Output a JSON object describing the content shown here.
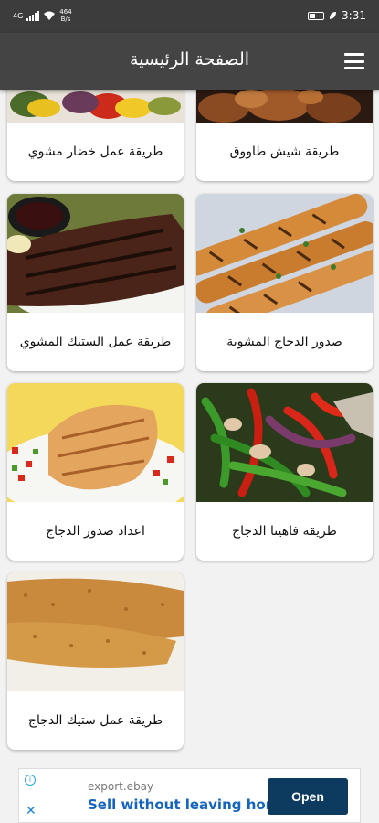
{
  "status_bar": {
    "network": "4G",
    "speed_value": "464",
    "speed_unit": "B/s",
    "time": "3:31"
  },
  "app_bar": {
    "title": "الصفحة الرئيسية",
    "menu_icon": "hamburger-menu-icon"
  },
  "recipes": [
    {
      "title": "طريقة شيش طاووق",
      "image": "grilled-chicken-pieces"
    },
    {
      "title": "طريقة عمل خضار مشوي",
      "image": "grilled-vegetables"
    },
    {
      "title": "صدور الدجاج المشوية",
      "image": "grilled-chicken-skewers"
    },
    {
      "title": "طريقة عمل الستيك المشوي",
      "image": "grilled-steak"
    },
    {
      "title": "طريقة فاهيتا الدجاج",
      "image": "chicken-fajita"
    },
    {
      "title": "اعداد صدور الدجاج",
      "image": "chicken-breast-plate"
    },
    {
      "title": "طريقة عمل ستيك الدجاج",
      "image": "breaded-chicken-steak"
    }
  ],
  "ad": {
    "source": "export.ebay",
    "headline": "Sell without leaving home",
    "button_label": "Open",
    "info_icon": "ad-choices-icon",
    "close_icon": "close-icon"
  },
  "colors": {
    "status_bar": "#3c3c3c",
    "app_bar": "#444444",
    "background": "#f2f2f2",
    "ad_button": "#0d3a5f",
    "ad_headline": "#1565c0"
  }
}
